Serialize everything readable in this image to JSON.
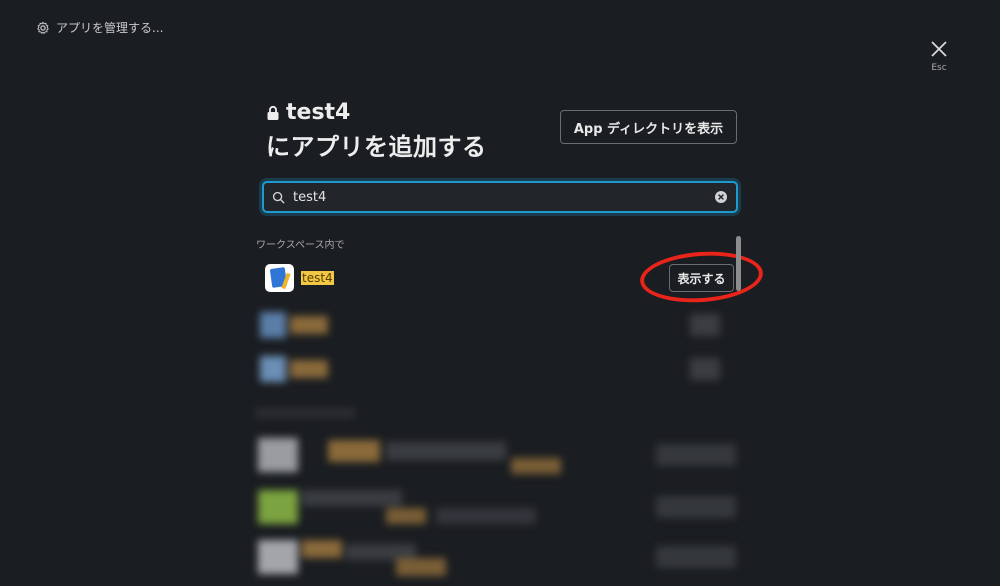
{
  "header": {
    "manage_apps_label": "アプリを管理する...",
    "close_label": "Esc"
  },
  "modal": {
    "channel_name": "test4",
    "title_suffix": "にアプリを追加する",
    "app_directory_button": "App ディレクトリを表示"
  },
  "search": {
    "value": "test4",
    "placeholder": ""
  },
  "results": {
    "section_label": "ワークスペース内で",
    "items": [
      {
        "name": "test4",
        "action_label": "表示する"
      }
    ]
  },
  "colors": {
    "background": "#1a1d21",
    "focus_ring": "#1d9bd1",
    "highlight": "#f2c744",
    "annotation_red": "#e8241b"
  }
}
